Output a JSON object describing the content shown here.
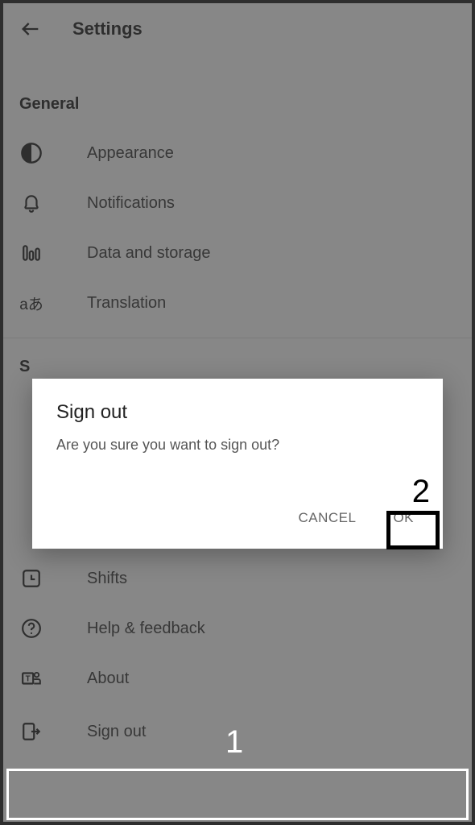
{
  "header": {
    "title": "Settings"
  },
  "sections": {
    "general": {
      "title": "General",
      "items": {
        "appearance": "Appearance",
        "notifications": "Notifications",
        "data_storage": "Data and storage",
        "translation": "Translation"
      }
    },
    "more": {
      "items": {
        "shifts": "Shifts",
        "help": "Help & feedback",
        "about": "About",
        "signout": "Sign out"
      }
    }
  },
  "dialog": {
    "title": "Sign out",
    "message": "Are you sure you want to sign out?",
    "cancel": "CANCEL",
    "ok": "OK"
  },
  "annotations": {
    "one": "1",
    "two": "2"
  },
  "partial_letter": "S"
}
